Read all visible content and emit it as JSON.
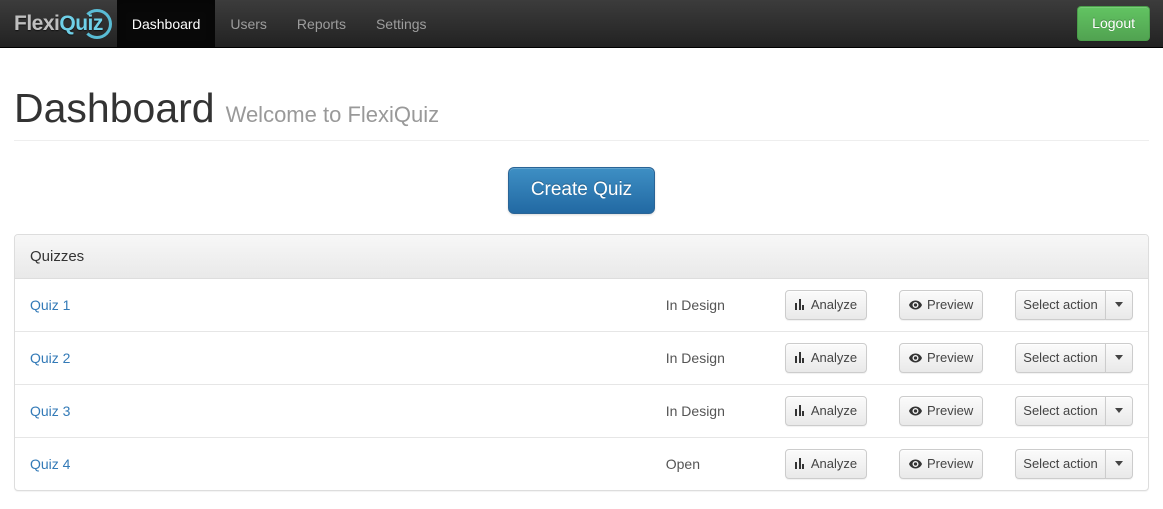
{
  "navbar": {
    "brand": {
      "part1": "Flexi",
      "part2": "Quiz"
    },
    "items": [
      {
        "label": "Dashboard",
        "active": true
      },
      {
        "label": "Users",
        "active": false
      },
      {
        "label": "Reports",
        "active": false
      },
      {
        "label": "Settings",
        "active": false
      }
    ],
    "logout_label": "Logout",
    "colors": {
      "background": "#3c3c3c",
      "active_background": "#080808",
      "link": "#9d9d9d",
      "brand_accent": "#6fd0e8",
      "logout": "#5cb85c"
    }
  },
  "page": {
    "title": "Dashboard",
    "subtitle": "Welcome to FlexiQuiz"
  },
  "create_quiz": {
    "label": "Create Quiz",
    "color": "#2b7cb8"
  },
  "panel": {
    "heading": "Quizzes",
    "actions": {
      "analyze_label": "Analyze",
      "preview_label": "Preview",
      "select_action_label": "Select action"
    },
    "rows": [
      {
        "name": "Quiz 1",
        "status": "In Design"
      },
      {
        "name": "Quiz 2",
        "status": "In Design"
      },
      {
        "name": "Quiz 3",
        "status": "In Design"
      },
      {
        "name": "Quiz 4",
        "status": "Open"
      }
    ]
  },
  "icons": {
    "analyze": "bar-chart-icon",
    "preview": "eye-icon",
    "dropdown": "caret-down-icon"
  }
}
